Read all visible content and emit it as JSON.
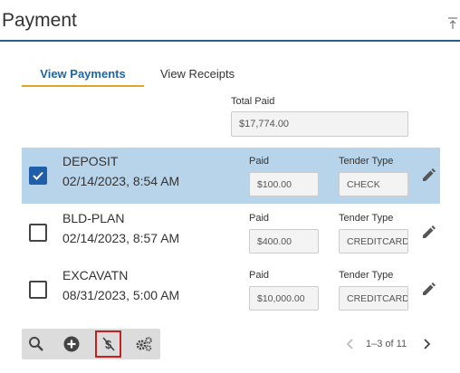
{
  "header": {
    "title": "Payment",
    "collapse_icon": "collapse-top-icon"
  },
  "tabs": [
    {
      "label": "View Payments",
      "active": true
    },
    {
      "label": "View Receipts",
      "active": false
    }
  ],
  "total": {
    "label": "Total Paid",
    "value": "$17,774.00"
  },
  "columns": {
    "paid": "Paid",
    "tender": "Tender Type"
  },
  "rows": [
    {
      "type": "DEPOSIT",
      "date": "02/14/2023, 8:54 AM",
      "paid": "$100.00",
      "tender": "CHECK",
      "checked": true
    },
    {
      "type": "BLD-PLAN",
      "date": "02/14/2023, 8:57 AM",
      "paid": "$400.00",
      "tender": "CREDITCARD",
      "checked": false
    },
    {
      "type": "EXCAVATN",
      "date": "08/31/2023, 5:00 AM",
      "paid": "$10,000.00",
      "tender": "CREDITCARD",
      "checked": false
    }
  ],
  "toolbar": {
    "buttons": [
      "search-icon",
      "add-circle-icon",
      "no-money-icon",
      "settings-gears-icon"
    ],
    "highlighted": "no-money-icon",
    "highlight_color": "#c81e1e"
  },
  "pager": {
    "text": "1–3 of 11"
  },
  "colors": {
    "selected_row": "#b8d4ea",
    "tab_accent": "#e0a526",
    "tab_text": "#1a66a8",
    "header_rule": "#2a5b8f",
    "checkbox": "#1f5ea8"
  }
}
